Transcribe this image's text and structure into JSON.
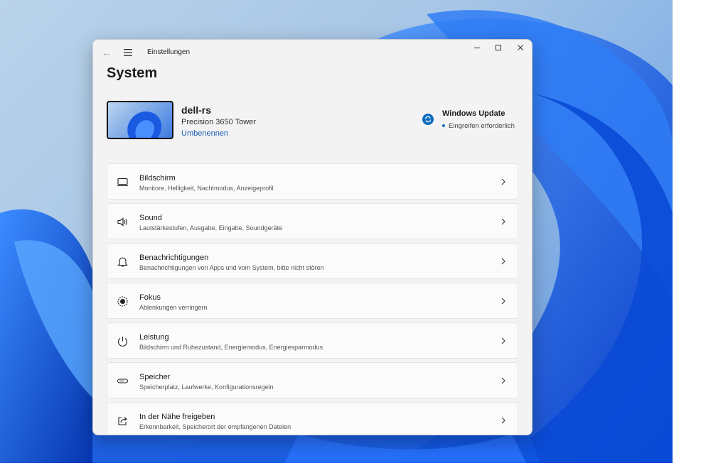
{
  "window": {
    "app_title": "Einstellungen",
    "page_title": "System"
  },
  "device": {
    "name": "dell-rs",
    "model": "Precision 3650 Tower",
    "rename_label": "Umbenennen"
  },
  "windows_update": {
    "title": "Windows Update",
    "status": "Eingreifen erforderlich",
    "icon": "sync-icon",
    "accent_color": "#0f6cbd"
  },
  "settings": [
    {
      "label": "Bildschirm",
      "description": "Monitore, Helligkeit, Nachtmodus, Anzeigeprofil",
      "icon": "display-icon"
    },
    {
      "label": "Sound",
      "description": "Lautstärkestufen, Ausgabe, Eingabe, Soundgeräte",
      "icon": "speaker-icon"
    },
    {
      "label": "Benachrichtigungen",
      "description": "Benachrichtigungen von Apps und vom System, bitte nicht stören",
      "icon": "bell-icon"
    },
    {
      "label": "Fokus",
      "description": "Ablenkungen verringern",
      "icon": "focus-icon"
    },
    {
      "label": "Leistung",
      "description": "Bildschirm und Ruhezustand, Energiemodus, Energiesparmodus",
      "icon": "power-icon"
    },
    {
      "label": "Speicher",
      "description": "Speicherplatz, Laufwerke, Konfigurationsregeln",
      "icon": "storage-icon"
    },
    {
      "label": "In der Nähe freigeben",
      "description": "Erkennbarkeit, Speicherort der empfangenen Dateien",
      "icon": "share-icon"
    }
  ]
}
